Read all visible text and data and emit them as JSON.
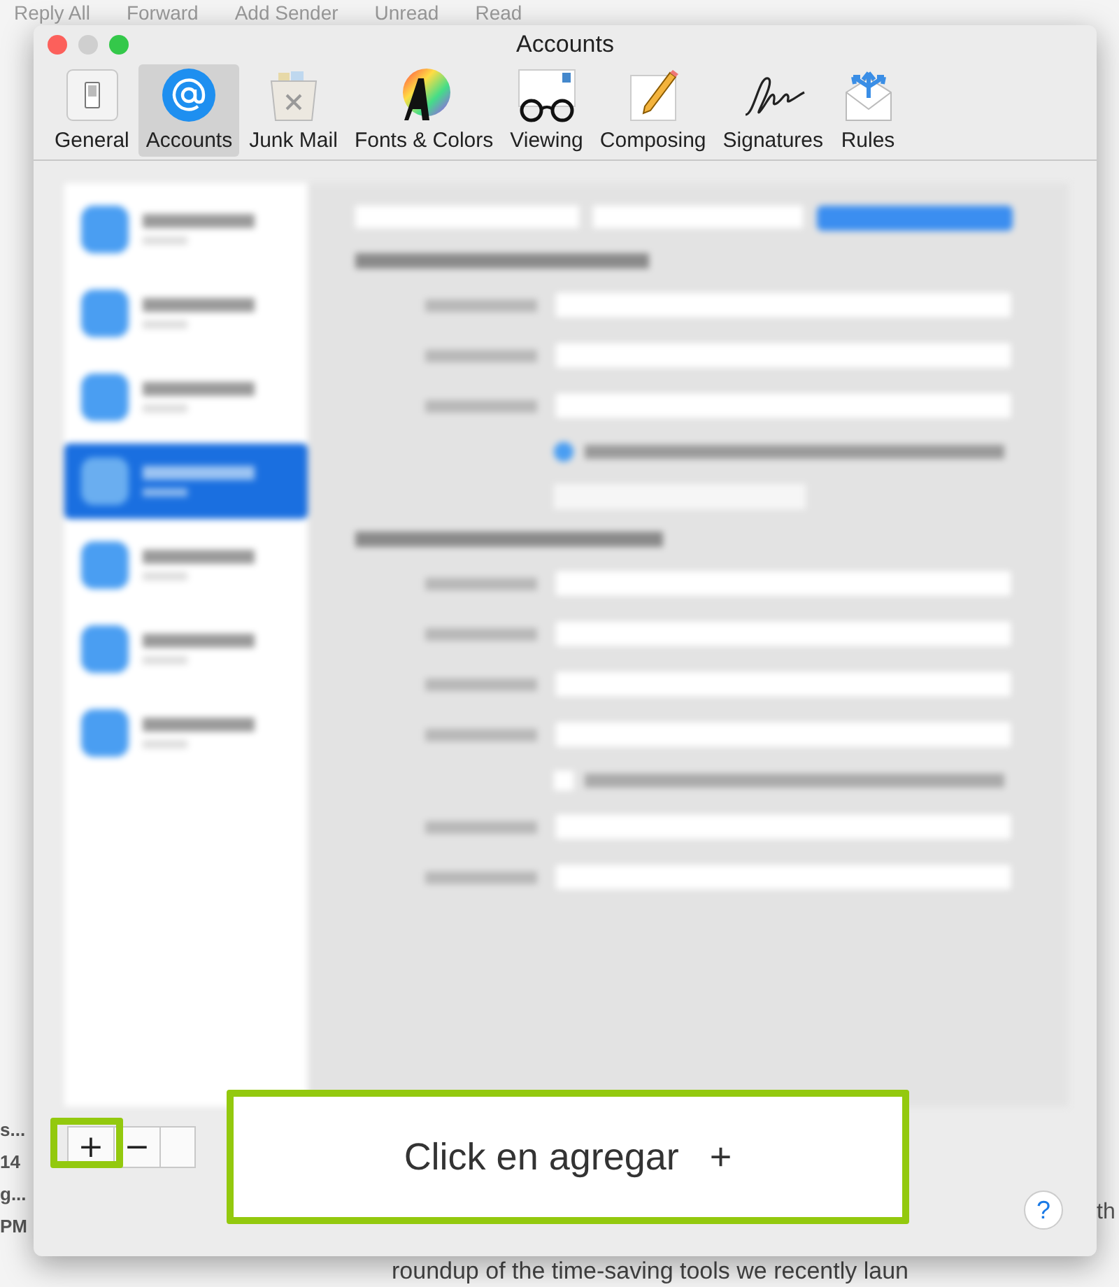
{
  "background_app": {
    "toolbar": [
      "Reply All",
      "Forward",
      "Add Sender",
      "Unread",
      "Read"
    ],
    "list_fragments": [
      "s...",
      "14",
      "g...",
      "PM"
    ],
    "preview_fragments": [
      "th",
      "roundup of the time-saving tools we recently laun"
    ]
  },
  "window": {
    "title": "Accounts"
  },
  "tabs": [
    {
      "label": "General",
      "kind": "general",
      "selected": false
    },
    {
      "label": "Accounts",
      "kind": "accounts",
      "selected": true
    },
    {
      "label": "Junk Mail",
      "kind": "junk",
      "selected": false
    },
    {
      "label": "Fonts & Colors",
      "kind": "fonts",
      "selected": false
    },
    {
      "label": "Viewing",
      "kind": "viewing",
      "selected": false
    },
    {
      "label": "Composing",
      "kind": "composing",
      "selected": false
    },
    {
      "label": "Signatures",
      "kind": "signatures",
      "selected": false
    },
    {
      "label": "Rules",
      "kind": "rules",
      "selected": false
    }
  ],
  "account_list_buttons": [
    "+",
    "−"
  ],
  "callout": {
    "text": "Click en agregar",
    "symbol": "+"
  },
  "help_button": "?"
}
